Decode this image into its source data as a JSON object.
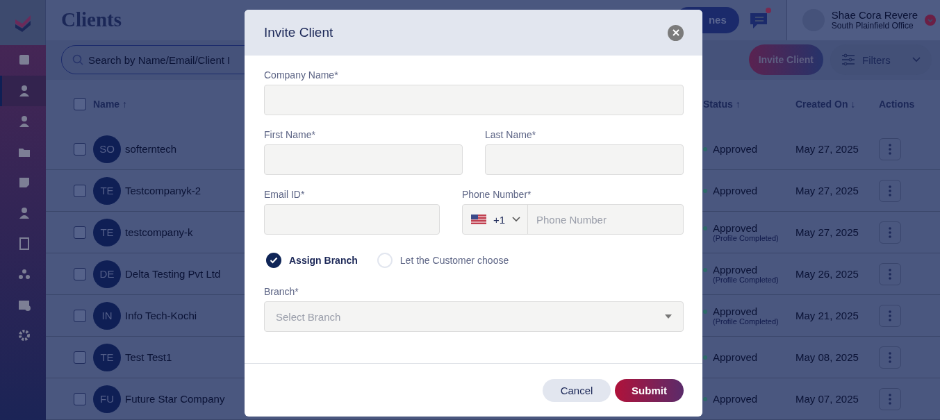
{
  "sidebar": {
    "items": [
      {
        "selected": false
      },
      {
        "selected": true
      },
      {
        "selected": false
      },
      {
        "selected": false
      },
      {
        "selected": false
      },
      {
        "selected": false
      },
      {
        "selected": false
      },
      {
        "selected": false
      },
      {
        "selected": false
      },
      {
        "selected": false
      }
    ]
  },
  "header": {
    "title": "Clients",
    "button": "nes",
    "notification": true,
    "user": {
      "name": "Shae Cora Revere",
      "office": "South Plainfield Office"
    }
  },
  "toolbar": {
    "search_placeholder": "Search by Name/Email/Client I",
    "invite_button": "Invite Client",
    "filters_button": "Filters"
  },
  "table": {
    "select_all_checked": false,
    "columns": [
      "Name ↑",
      "Status ↑",
      "Created On ↓",
      "Actions"
    ],
    "rows": [
      {
        "checked": false,
        "initials": "SO",
        "name": "softerntech",
        "status": "Approved",
        "date": "May 27, 2025"
      },
      {
        "checked": false,
        "initials": "TE",
        "name": "Testcompanyk-2",
        "status": "Approved",
        "date": "May 27, 2025"
      },
      {
        "checked": false,
        "initials": "TE",
        "name": "testcompany-k",
        "status": "Approved",
        "note": "(Profile Completed)",
        "date": "May 27, 2025"
      },
      {
        "checked": false,
        "initials": "DE",
        "name": "Delta Testing Pvt Ltd",
        "status": "Approved",
        "note": "(Profile Completed)",
        "date": "May 26, 2025"
      },
      {
        "checked": false,
        "initials": "IN",
        "name": "Info Tech-Kochi",
        "status": "Approved",
        "note": "(Profile Completed)",
        "date": "May 21, 2025"
      },
      {
        "checked": false,
        "initials": "TE",
        "name": "Test Test1",
        "status": "Approved",
        "date": "May 08, 2025"
      },
      {
        "checked": false,
        "initials": "FU",
        "name": "Future Star Company",
        "status": "Approved",
        "date": "May 07, 2025"
      }
    ]
  },
  "dialog": {
    "title": "Invite Client",
    "company_label": "Company Name*",
    "first_name_label": "First Name*",
    "last_name_label": "Last Name*",
    "email_label": "Email ID*",
    "phone_label": "Phone Number*",
    "country_code": "+1",
    "phone_placeholder": "Phone Number",
    "options": [
      {
        "label": "Assign Branch",
        "selected": true
      },
      {
        "label": "Let the Customer choose",
        "selected": false
      }
    ],
    "branch_label": "Branch*",
    "branch_placeholder": "Select Branch",
    "cancel": "Cancel",
    "submit": "Submit"
  }
}
